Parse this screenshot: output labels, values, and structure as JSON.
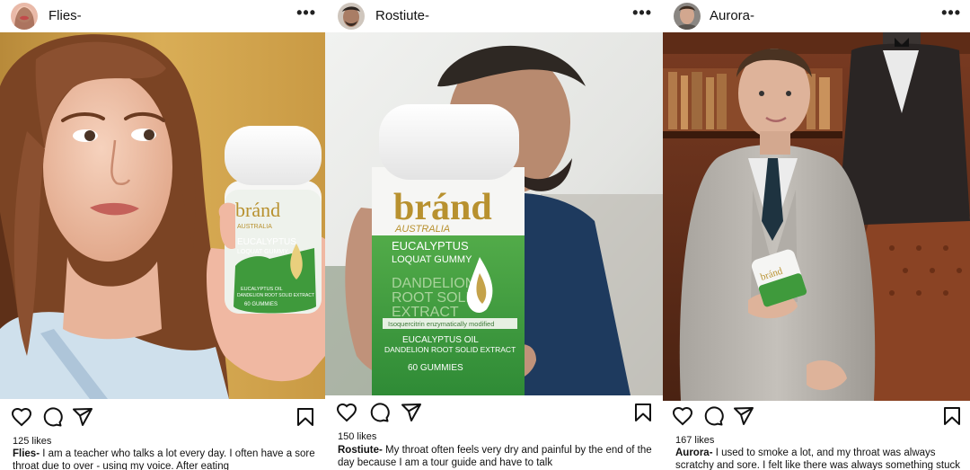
{
  "posts": [
    {
      "username": "Flies-",
      "likes": "125 likes",
      "caption_user": "Flies-",
      "caption_text": " I am a teacher who talks a lot every day. I often have a sore throat due to over - using my voice. After eating",
      "more_label": "•••",
      "product": {
        "brand": "bránd",
        "origin": "AUSTRALIA",
        "name1": "EUCALYPTUS",
        "name2": "LOQUAT GUMMY",
        "sub1": "EUCALYPTUS OIL",
        "sub2": "DANDELION ROOT SOLID EXTRACT",
        "count": "60 GUMMIES"
      }
    },
    {
      "username": "Rostiute-",
      "likes": "150 likes",
      "caption_user": "Rostiute-",
      "caption_text": " My throat often feels very dry and painful by the end of the day because I am a tour guide and have to talk",
      "more_label": "•••",
      "product": {
        "brand": "bránd",
        "origin": "AUSTRALIA",
        "name1": "EUCALYPTUS",
        "name2": "LOQUAT GUMMY",
        "big1": "DANDELION",
        "big2": "ROOT SOLID",
        "big3": "EXTRACT",
        "band": "Isoquercitrin enzymatically modified",
        "sub1": "EUCALYPTUS OIL",
        "sub2": "DANDELION ROOT SOLID EXTRACT",
        "count": "60 GUMMIES"
      }
    },
    {
      "username": "Aurora-",
      "likes": "167 likes",
      "caption_user": "Aurora-",
      "caption_text": " I used to smoke a lot, and my throat was always scratchy and sore. I felt like there was always something stuck",
      "more_label": "•••",
      "product": {
        "brand": "bránd"
      }
    }
  ],
  "colors": {
    "brand_green": "#3f9a3c",
    "gold": "#b8912f",
    "text": "#111111"
  },
  "icons": [
    "heart-icon",
    "comment-icon",
    "share-icon",
    "bookmark-icon",
    "more-icon"
  ]
}
